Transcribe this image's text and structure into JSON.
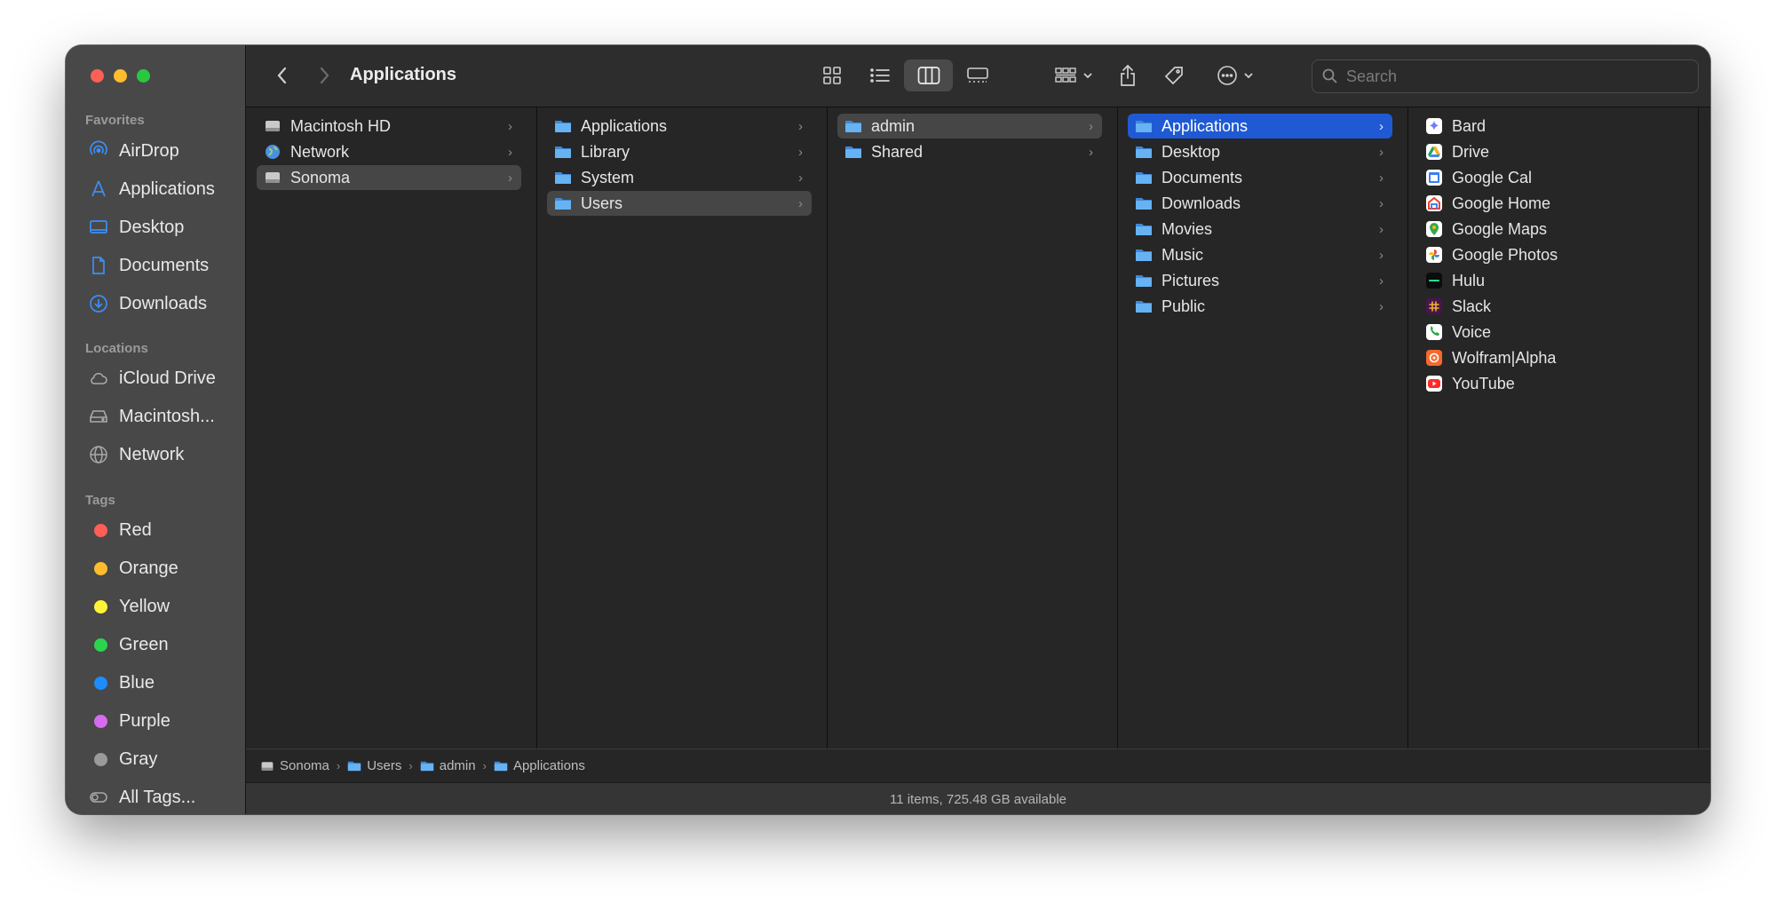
{
  "window": {
    "title": "Applications"
  },
  "sidebar": {
    "favorites_header": "Favorites",
    "favorites": [
      {
        "label": "AirDrop",
        "icon": "airdrop-icon"
      },
      {
        "label": "Applications",
        "icon": "applications-icon"
      },
      {
        "label": "Desktop",
        "icon": "desktop-icon"
      },
      {
        "label": "Documents",
        "icon": "document-icon"
      },
      {
        "label": "Downloads",
        "icon": "download-icon"
      }
    ],
    "locations_header": "Locations",
    "locations": [
      {
        "label": "iCloud Drive",
        "icon": "cloud-icon"
      },
      {
        "label": "Macintosh...",
        "icon": "harddrive-icon"
      },
      {
        "label": "Network",
        "icon": "globe-icon"
      }
    ],
    "tags_header": "Tags",
    "tags": [
      {
        "label": "Red",
        "color": "#ff5f57"
      },
      {
        "label": "Orange",
        "color": "#febc2e"
      },
      {
        "label": "Yellow",
        "color": "#fff33a"
      },
      {
        "label": "Green",
        "color": "#2bd44f"
      },
      {
        "label": "Blue",
        "color": "#1d8cff"
      },
      {
        "label": "Purple",
        "color": "#d66bf0"
      },
      {
        "label": "Gray",
        "color": "#9a9a9a"
      }
    ],
    "all_tags": "All Tags..."
  },
  "toolbar": {
    "back": "chevron-left-icon",
    "forward": "chevron-right-icon",
    "view_modes": [
      "icon-view",
      "list-view",
      "column-view",
      "gallery-view"
    ],
    "active_view": "column-view",
    "search_placeholder": "Search"
  },
  "columns": [
    {
      "items": [
        {
          "label": "Macintosh HD",
          "icon": "harddrive-icon",
          "selected": ""
        },
        {
          "label": "Network",
          "icon": "globe-icon",
          "selected": ""
        },
        {
          "label": "Sonoma",
          "icon": "harddrive-icon",
          "selected": "gray"
        }
      ]
    },
    {
      "items": [
        {
          "label": "Applications",
          "icon": "folder-icon",
          "selected": ""
        },
        {
          "label": "Library",
          "icon": "folder-icon",
          "selected": ""
        },
        {
          "label": "System",
          "icon": "folder-icon",
          "selected": ""
        },
        {
          "label": "Users",
          "icon": "folder-icon",
          "selected": "gray"
        }
      ]
    },
    {
      "items": [
        {
          "label": "admin",
          "icon": "folder-icon",
          "selected": "gray"
        },
        {
          "label": "Shared",
          "icon": "folder-icon",
          "selected": ""
        }
      ]
    },
    {
      "items": [
        {
          "label": "Applications",
          "icon": "folder-icon",
          "selected": "blue"
        },
        {
          "label": "Desktop",
          "icon": "folder-icon",
          "selected": ""
        },
        {
          "label": "Documents",
          "icon": "folder-icon",
          "selected": ""
        },
        {
          "label": "Downloads",
          "icon": "folder-icon",
          "selected": ""
        },
        {
          "label": "Movies",
          "icon": "folder-icon",
          "selected": ""
        },
        {
          "label": "Music",
          "icon": "folder-icon",
          "selected": ""
        },
        {
          "label": "Pictures",
          "icon": "folder-icon",
          "selected": ""
        },
        {
          "label": "Public",
          "icon": "folder-icon",
          "selected": ""
        }
      ]
    },
    {
      "items": [
        {
          "label": "Bard",
          "icon": "bard-app-icon",
          "color": "#6f7df5",
          "selected": ""
        },
        {
          "label": "Drive",
          "icon": "drive-app-icon",
          "color": "#f2b21a",
          "selected": ""
        },
        {
          "label": "Google Cal",
          "icon": "calendar-app-icon",
          "color": "#3d7ef0",
          "selected": ""
        },
        {
          "label": "Google Home",
          "icon": "home-app-icon",
          "color": "#e94235",
          "selected": ""
        },
        {
          "label": "Google Maps",
          "icon": "maps-app-icon",
          "color": "#34a853",
          "selected": ""
        },
        {
          "label": "Google Photos",
          "icon": "photos-app-icon",
          "color": "#fbbc04",
          "selected": ""
        },
        {
          "label": "Hulu",
          "icon": "hulu-app-icon",
          "color": "#1ce783",
          "selected": ""
        },
        {
          "label": "Slack",
          "icon": "slack-app-icon",
          "color": "#4a154b",
          "selected": ""
        },
        {
          "label": "Voice",
          "icon": "voice-app-icon",
          "color": "#2fa34a",
          "selected": ""
        },
        {
          "label": "Wolfram|Alpha",
          "icon": "wolfram-app-icon",
          "color": "#f26a2c",
          "selected": ""
        },
        {
          "label": "YouTube",
          "icon": "youtube-app-icon",
          "color": "#ff2a24",
          "selected": ""
        }
      ]
    }
  ],
  "path": [
    {
      "label": "Sonoma",
      "icon": "harddrive-icon"
    },
    {
      "label": "Users",
      "icon": "folder-icon"
    },
    {
      "label": "admin",
      "icon": "folder-icon"
    },
    {
      "label": "Applications",
      "icon": "folder-icon"
    }
  ],
  "status": "11 items, 725.48 GB available",
  "colors": {
    "accent": "#1f5ad4",
    "folder": "#5aa9f0"
  }
}
